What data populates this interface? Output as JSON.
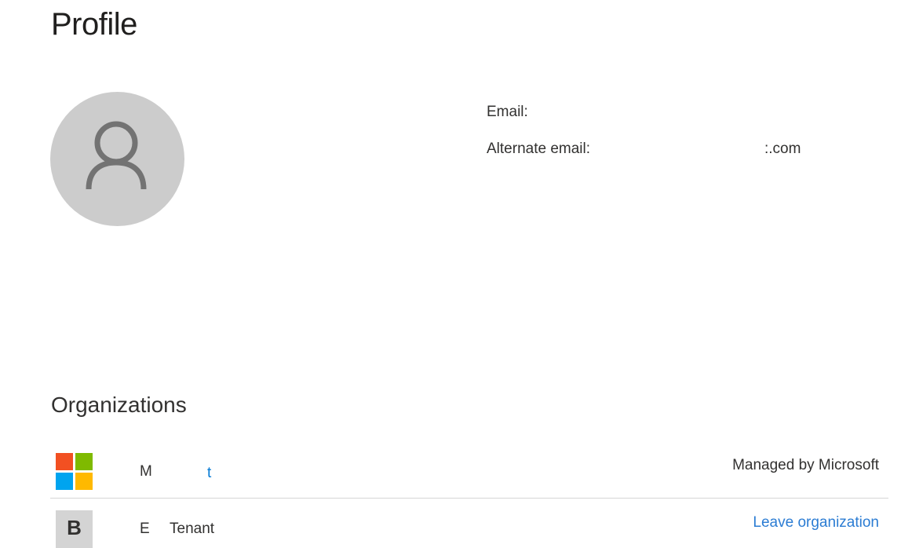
{
  "page": {
    "title": "Profile"
  },
  "profile": {
    "avatar_icon": "person-icon",
    "email_label": "Email:",
    "alternate_email_label": "Alternate email:",
    "alternate_email_value_visible": ":.com"
  },
  "organizations": {
    "title": "Organizations",
    "items": [
      {
        "logo": "microsoft-logo-icon",
        "name_visible": "M",
        "name_tail_visible": "t",
        "status": "Managed by Microsoft"
      },
      {
        "tile_initial": "B",
        "name_visible": "E",
        "name_suffix": "Tenant",
        "action": "Leave organization"
      }
    ]
  },
  "colors": {
    "avatar_bg": "#cccccc",
    "avatar_icon": "#737373",
    "link": "#2b7cd3",
    "ms_red": "#f25022",
    "ms_green": "#7fba00",
    "ms_blue": "#00a4ef",
    "ms_yellow": "#ffb900"
  }
}
